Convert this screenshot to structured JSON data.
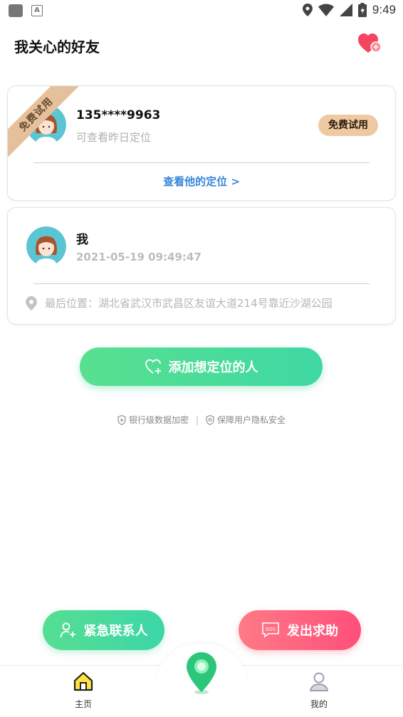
{
  "status_bar": {
    "time": "9:49",
    "app_badge": "A"
  },
  "header": {
    "title": "我关心的好友"
  },
  "friends": [
    {
      "ribbon": "免费试用",
      "name": "135****9963",
      "subtitle": "可查看昨日定位",
      "badge": "免费试用",
      "action": "查看他的定位 >"
    }
  ],
  "me": {
    "name": "我",
    "timestamp": "2021-05-19 09:49:47",
    "location": "最后位置：湖北省武汉市武昌区友谊大道214号靠近沙湖公园"
  },
  "add_button": {
    "label": "添加想定位的人"
  },
  "security": [
    "银行级数据加密",
    "保障用户隐私安全"
  ],
  "fab": {
    "emergency": "紧急联系人",
    "sos": "发出求助",
    "sos_icon_text": "SOS"
  },
  "nav": {
    "home": "主页",
    "mine": "我的"
  },
  "colors": {
    "accent_green": "#4fdc98",
    "sos_red": "#ff5a7e",
    "link_blue": "#3a86d9",
    "trial_tan": "#efc9a2"
  }
}
